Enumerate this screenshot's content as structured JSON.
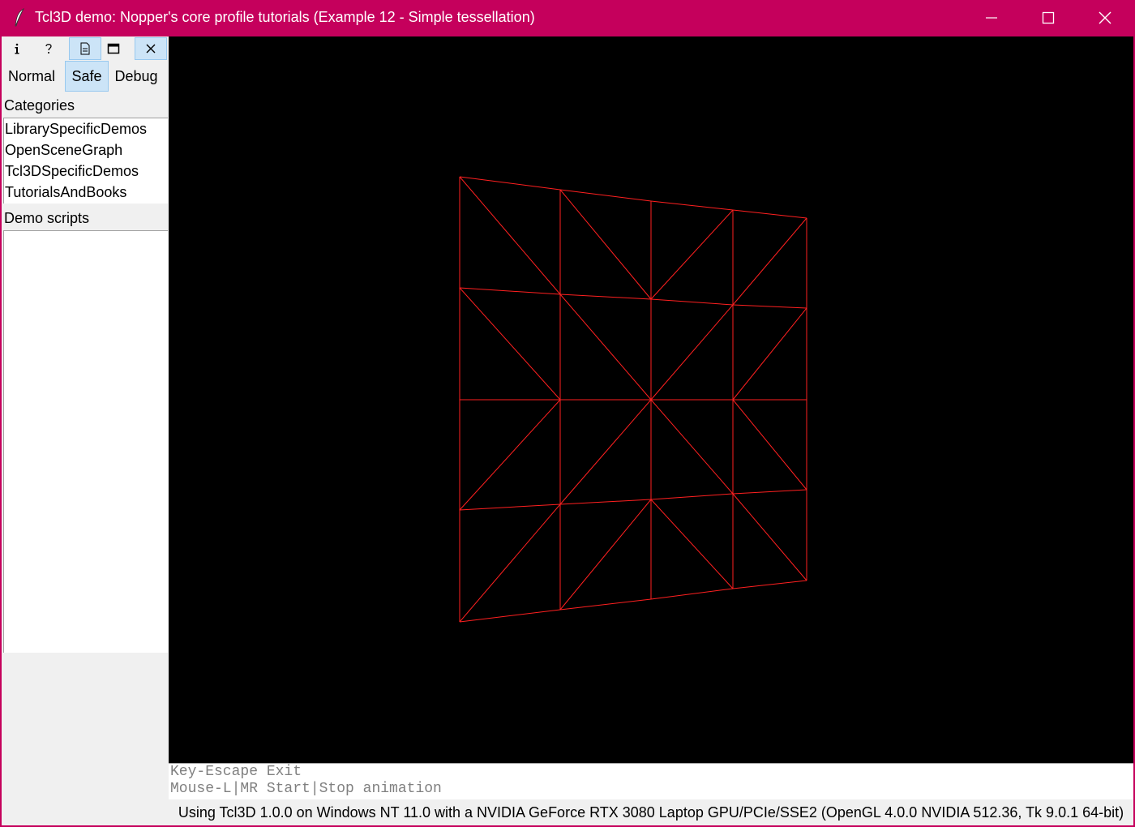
{
  "window": {
    "title": "Tcl3D demo: Nopper's core profile tutorials (Example 12 - Simple tessellation)",
    "accent_color": "#c5005c"
  },
  "toolbar": {
    "icons": [
      "info-icon",
      "help-icon",
      "document-icon",
      "maximize-view-icon",
      "close-icon"
    ]
  },
  "modes": {
    "normal": "Normal",
    "safe": "Safe",
    "debug": "Debug",
    "selected": "Safe"
  },
  "categories": {
    "label": "Categories",
    "items": [
      "LibrarySpecificDemos",
      "OpenSceneGraph",
      "Tcl3DSpecificDemos",
      "TutorialsAndBooks"
    ]
  },
  "demo_scripts": {
    "label": "Demo scripts",
    "items": []
  },
  "viewport": {
    "background": "#000000",
    "wire_color": "#ff2020"
  },
  "info": {
    "line1": "Key-Escape Exit",
    "line2": "Mouse-L|MR Start|Stop animation"
  },
  "status": {
    "text": "Using Tcl3D 1.0.0 on Windows NT 11.0 with a NVIDIA GeForce RTX 3080 Laptop GPU/PCIe/SSE2 (OpenGL 4.0.0 NVIDIA 512.36, Tk 9.0.1 64-bit)"
  }
}
